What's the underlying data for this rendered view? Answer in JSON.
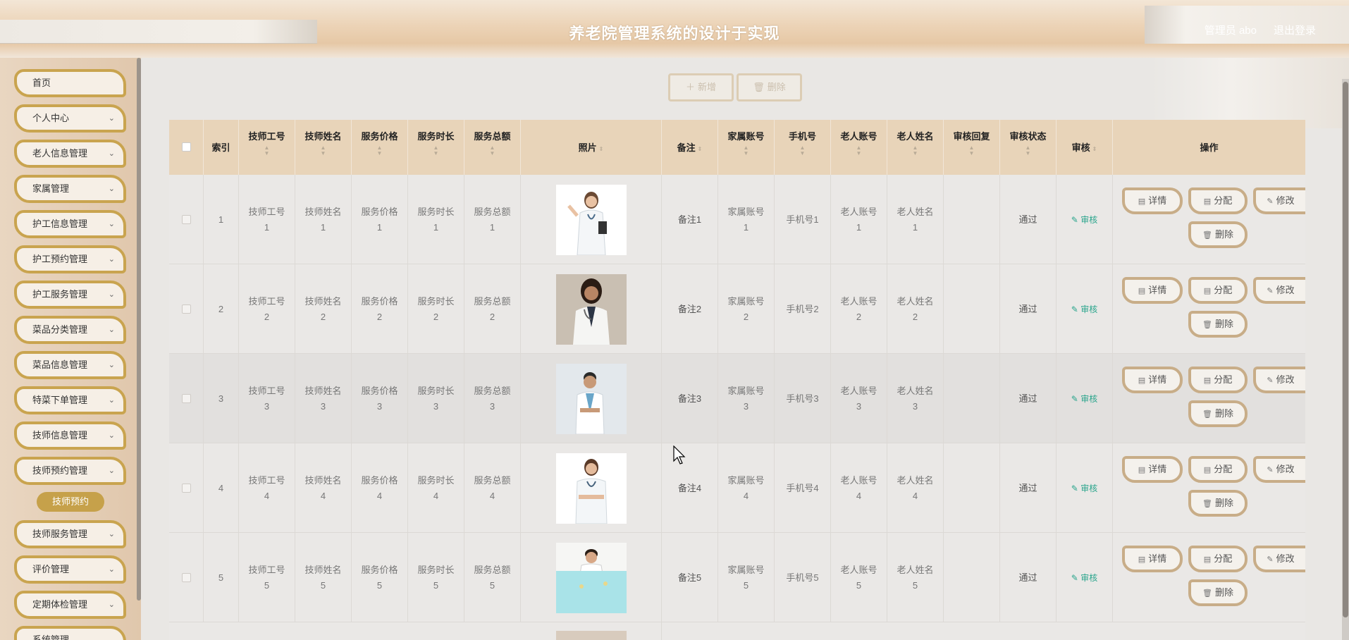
{
  "header": {
    "title": "养老院管理系统的设计于实现",
    "user": "管理员 abo",
    "logout": "退出登录"
  },
  "sidebar": {
    "items": [
      {
        "label": "首页",
        "has_arrow": false
      },
      {
        "label": "个人中心",
        "has_arrow": true
      },
      {
        "label": "老人信息管理",
        "has_arrow": true
      },
      {
        "label": "家属管理",
        "has_arrow": true
      },
      {
        "label": "护工信息管理",
        "has_arrow": true
      },
      {
        "label": "护工预约管理",
        "has_arrow": true
      },
      {
        "label": "护工服务管理",
        "has_arrow": true
      },
      {
        "label": "菜品分类管理",
        "has_arrow": true
      },
      {
        "label": "菜品信息管理",
        "has_arrow": true
      },
      {
        "label": "特菜下单管理",
        "has_arrow": true
      },
      {
        "label": "技师信息管理",
        "has_arrow": true
      },
      {
        "label": "技师预约管理",
        "has_arrow": true
      },
      {
        "label": "技师服务管理",
        "has_arrow": true
      },
      {
        "label": "评价管理",
        "has_arrow": true
      },
      {
        "label": "定期体检管理",
        "has_arrow": true
      },
      {
        "label": "系统管理",
        "has_arrow": true
      }
    ],
    "active_sub": "技师预约"
  },
  "toolbar": {
    "add": "新增",
    "delete": "删除"
  },
  "table": {
    "headers": {
      "index": "索引",
      "tech_no": "技师工号",
      "tech_name": "技师姓名",
      "price": "服务价格",
      "duration": "服务时长",
      "total": "服务总额",
      "photo": "照片",
      "remark": "备注",
      "family_account": "家属账号",
      "phone": "手机号",
      "elder_account": "老人账号",
      "elder_name": "老人姓名",
      "audit_reply": "审核回复",
      "audit_status": "审核状态",
      "audit": "审核",
      "ops": "操作"
    },
    "rows": [
      {
        "index": "1",
        "tech_no": [
          "技师工号",
          "1"
        ],
        "tech_name": [
          "技师姓名",
          "1"
        ],
        "price": [
          "服务价格",
          "1"
        ],
        "duration": [
          "服务时长",
          "1"
        ],
        "total": [
          "服务总额",
          "1"
        ],
        "photo": "doctor-female-clipboard",
        "remark": "备注1",
        "family_account": [
          "家属账号",
          "1"
        ],
        "phone": "手机号1",
        "elder_account": [
          "老人账号",
          "1"
        ],
        "elder_name": [
          "老人姓名",
          "1"
        ],
        "audit_reply": "",
        "audit_status": "通过",
        "audit": "审核"
      },
      {
        "index": "2",
        "tech_no": [
          "技师工号",
          "2"
        ],
        "tech_name": [
          "技师姓名",
          "2"
        ],
        "price": [
          "服务价格",
          "2"
        ],
        "duration": [
          "服务时长",
          "2"
        ],
        "total": [
          "服务总额",
          "2"
        ],
        "photo": "doctor-female-portrait",
        "remark": "备注2",
        "family_account": [
          "家属账号",
          "2"
        ],
        "phone": "手机号2",
        "elder_account": [
          "老人账号",
          "2"
        ],
        "elder_name": [
          "老人姓名",
          "2"
        ],
        "audit_reply": "",
        "audit_status": "通过",
        "audit": "审核"
      },
      {
        "index": "3",
        "tech_no": [
          "技师工号",
          "3"
        ],
        "tech_name": [
          "技师姓名",
          "3"
        ],
        "price": [
          "服务价格",
          "3"
        ],
        "duration": [
          "服务时长",
          "3"
        ],
        "total": [
          "服务总额",
          "3"
        ],
        "photo": "doctor-male",
        "remark": "备注3",
        "family_account": [
          "家属账号",
          "3"
        ],
        "phone": "手机号3",
        "elder_account": [
          "老人账号",
          "3"
        ],
        "elder_name": [
          "老人姓名",
          "3"
        ],
        "audit_reply": "",
        "audit_status": "通过",
        "audit": "审核"
      },
      {
        "index": "4",
        "tech_no": [
          "技师工号",
          "4"
        ],
        "tech_name": [
          "技师姓名",
          "4"
        ],
        "price": [
          "服务价格",
          "4"
        ],
        "duration": [
          "服务时长",
          "4"
        ],
        "total": [
          "服务总额",
          "4"
        ],
        "photo": "doctor-female-arms-crossed",
        "remark": "备注4",
        "family_account": [
          "家属账号",
          "4"
        ],
        "phone": "手机号4",
        "elder_account": [
          "老人账号",
          "4"
        ],
        "elder_name": [
          "老人姓名",
          "4"
        ],
        "audit_reply": "",
        "audit_status": "通过",
        "audit": "审核"
      },
      {
        "index": "5",
        "tech_no": [
          "技师工号",
          "5"
        ],
        "tech_name": [
          "技师姓名",
          "5"
        ],
        "price": [
          "服务价格",
          "5"
        ],
        "duration": [
          "服务时长",
          "5"
        ],
        "total": [
          "服务总额",
          "5"
        ],
        "photo": "man-holding-sign",
        "remark": "备注5",
        "family_account": [
          "家属账号",
          "5"
        ],
        "phone": "手机号5",
        "elder_account": [
          "老人账号",
          "5"
        ],
        "elder_name": [
          "老人姓名",
          "5"
        ],
        "audit_reply": "",
        "audit_status": "通过",
        "audit": "审核"
      }
    ],
    "ops": {
      "detail": "详情",
      "assign": "分配",
      "edit": "修改",
      "delete": "删除"
    }
  },
  "colors": {
    "accent_gold": "#c9a44f",
    "header_tan": "#e8d4b9",
    "audit_green": "#2aa58c"
  }
}
